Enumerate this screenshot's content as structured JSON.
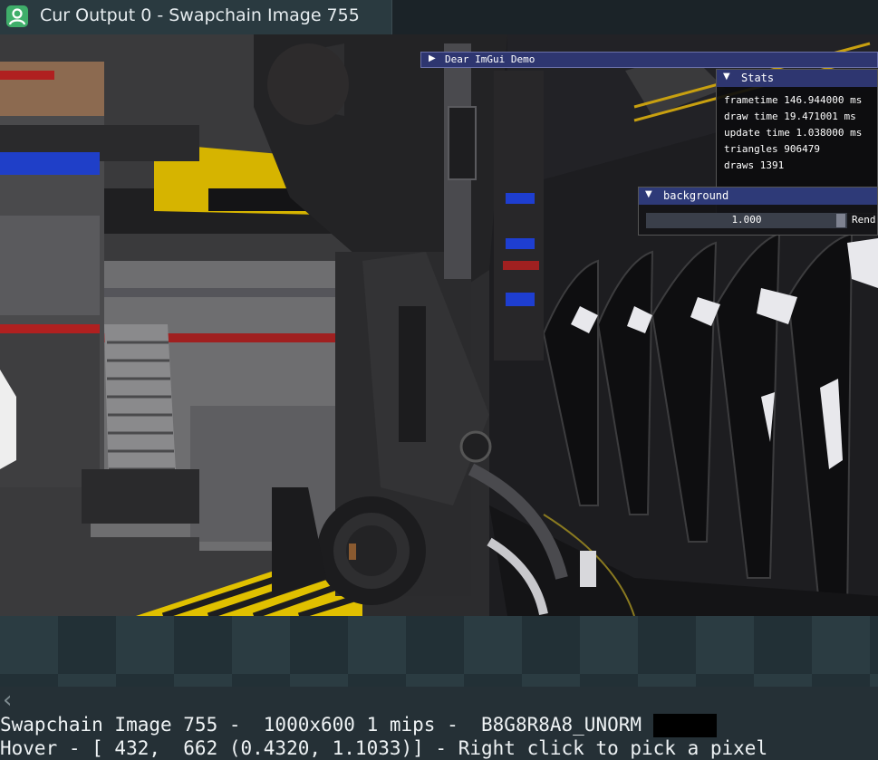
{
  "tab": {
    "title": "Cur Output 0 - Swapchain Image 755",
    "icon": "user-icon"
  },
  "imgui": {
    "demo_window": {
      "title": "Dear ImGui Demo",
      "collapsed_arrow": "▶"
    },
    "stats": {
      "title": "Stats",
      "arrow": "▼",
      "lines": [
        "frametime 146.944000 ms",
        "draw time 19.471001 ms",
        "update time 1.038000 ms",
        "triangles 906479",
        "draws 1391"
      ]
    },
    "background": {
      "title": "background",
      "arrow": "▼",
      "slider_value": "1.000",
      "label": "Rend"
    }
  },
  "status": {
    "line1": "Swapchain Image 755 -  1000x600 1 mips -  B8G8R8A8_UNORM ",
    "line2": "Hover - [ 432,  662 (0.4320, 1.1033)] - Right click to pick a pixel",
    "pixel_swatch_color": "#000000"
  },
  "scroll": {
    "left_arrow": "‹"
  },
  "colors": {
    "accent": "#2e3670",
    "tab_icon": "#3fae6a"
  }
}
